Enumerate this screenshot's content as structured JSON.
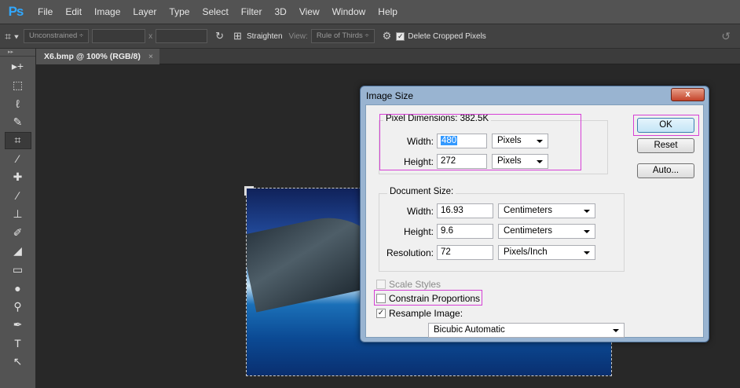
{
  "app": {
    "logo": "Ps"
  },
  "menu": [
    "File",
    "Edit",
    "Image",
    "Layer",
    "Type",
    "Select",
    "Filter",
    "3D",
    "View",
    "Window",
    "Help"
  ],
  "options": {
    "ratio": "Unconstrained",
    "swap": "x",
    "straighten": "Straighten",
    "view_label": "View:",
    "view_value": "Rule of Thirds",
    "delete_cropped": "Delete Cropped Pixels"
  },
  "document_tab": {
    "title": "X6.bmp @ 100% (RGB/8)",
    "close": "×"
  },
  "dialog": {
    "title": "Image Size",
    "close": "x",
    "pixel_dimensions": {
      "title": "Pixel Dimensions:  382.5K",
      "width_label": "Width:",
      "width_value": "480",
      "width_unit": "Pixels",
      "height_label": "Height:",
      "height_value": "272",
      "height_unit": "Pixels"
    },
    "document_size": {
      "title": "Document Size:",
      "width_label": "Width:",
      "width_value": "16.93",
      "width_unit": "Centimeters",
      "height_label": "Height:",
      "height_value": "9.6",
      "height_unit": "Centimeters",
      "resolution_label": "Resolution:",
      "resolution_value": "72",
      "resolution_unit": "Pixels/Inch"
    },
    "scale_styles": "Scale Styles",
    "constrain_proportions": "Constrain Proportions",
    "resample_image": "Resample Image:",
    "resample_method": "Bicubic Automatic",
    "buttons": {
      "ok": "OK",
      "reset": "Reset",
      "auto": "Auto..."
    },
    "checkbox_state": {
      "scale_styles": false,
      "constrain_proportions": false,
      "resample_image": true
    }
  },
  "colors": {
    "highlight": "#d640d6",
    "ui_dark": "#282828",
    "panel": "#535353"
  }
}
